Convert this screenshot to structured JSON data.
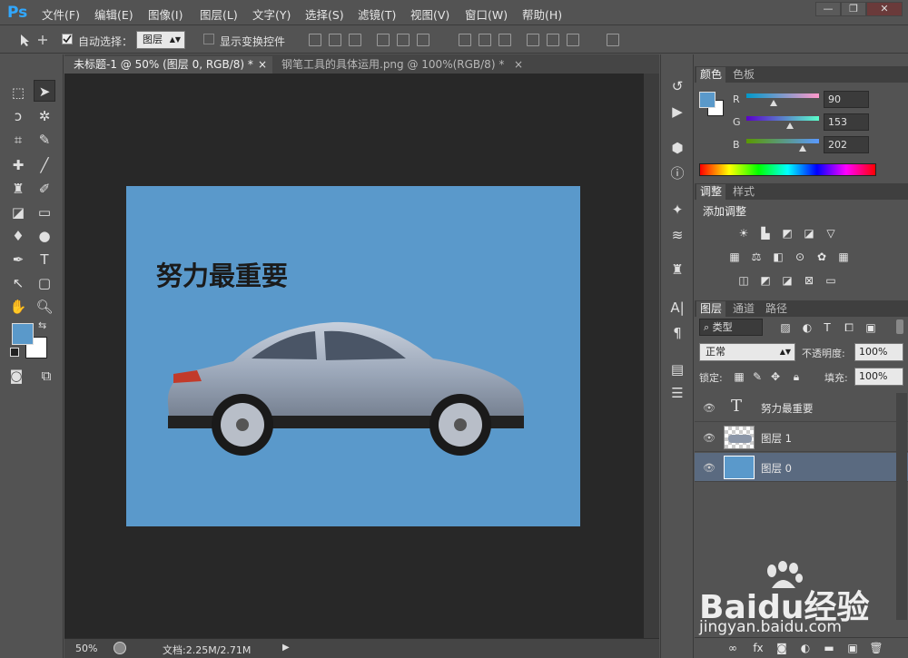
{
  "app": {
    "logo": "Ps"
  },
  "menu": [
    "文件(F)",
    "编辑(E)",
    "图像(I)",
    "图层(L)",
    "文字(Y)",
    "选择(S)",
    "滤镜(T)",
    "视图(V)",
    "窗口(W)",
    "帮助(H)"
  ],
  "window_controls": {
    "minimize": "—",
    "restore": "❐",
    "close": "✕"
  },
  "options": {
    "auto_select_label": "自动选择：",
    "auto_select_value": "图层",
    "show_transform_label": "显示变换控件"
  },
  "tabs": [
    {
      "label": "未标题-1 @ 50% (图层 0, RGB/8) *",
      "close": "×"
    },
    {
      "label": "钢笔工具的具体运用.png @ 100%(RGB/8) *",
      "close": "×"
    }
  ],
  "canvas": {
    "text": "努力最重要"
  },
  "status": {
    "zoom": "50%",
    "doc_info": "文档:2.25M/2.71M"
  },
  "color_panel": {
    "tabs": [
      "颜色",
      "色板"
    ],
    "r_label": "R",
    "r_value": "90",
    "g_label": "G",
    "g_value": "153",
    "b_label": "B",
    "b_value": "202",
    "foreground": "#5a99ca"
  },
  "adjust_panel": {
    "tabs": [
      "调整",
      "样式"
    ],
    "title": "添加调整"
  },
  "layers_panel": {
    "tabs": [
      "图层",
      "通道",
      "路径"
    ],
    "filter_kind": "类型",
    "blend_mode": "正常",
    "opacity_label": "不透明度:",
    "opacity_value": "100%",
    "lock_label": "锁定:",
    "fill_label": "填充:",
    "fill_value": "100%",
    "layers": [
      {
        "name": "努力最重要",
        "kind": "text"
      },
      {
        "name": "图层 1",
        "kind": "image"
      },
      {
        "name": "图层 0",
        "kind": "fill",
        "selected": true
      }
    ]
  },
  "watermark": {
    "brand": "Baidu经验",
    "url": "jingyan.baidu.com"
  },
  "colors": {
    "canvas_bg": "#5a99cb",
    "selected_layer": "#5a6a80",
    "accent": "#31a8ff"
  }
}
